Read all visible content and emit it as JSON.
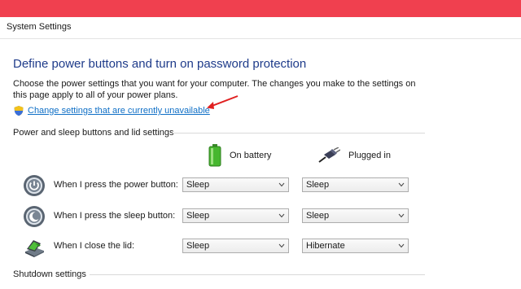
{
  "window": {
    "breadcrumb": "System Settings",
    "accent_band_color": "#f0404f"
  },
  "page": {
    "title": "Define power buttons and turn on password protection",
    "description": "Choose the power settings that you want for your computer. The changes you make to the settings on this page apply to all of your power plans.",
    "change_link": "Change settings that are currently unavailable"
  },
  "power_section": {
    "title": "Power and sleep buttons and lid settings",
    "columns": {
      "battery": "On battery",
      "plugged": "Plugged in"
    },
    "rows": [
      {
        "label": "When I press the power button:",
        "icon": "power-button-icon",
        "battery": "Sleep",
        "plugged": "Sleep"
      },
      {
        "label": "When I press the sleep button:",
        "icon": "sleep-button-icon",
        "battery": "Sleep",
        "plugged": "Sleep"
      },
      {
        "label": "When I close the lid:",
        "icon": "laptop-lid-icon",
        "battery": "Sleep",
        "plugged": "Hibernate"
      }
    ]
  },
  "shutdown_section": {
    "title": "Shutdown settings"
  },
  "colors": {
    "title": "#1e3b8a",
    "link": "#0f6fc6",
    "annotation_arrow": "#e02020"
  }
}
